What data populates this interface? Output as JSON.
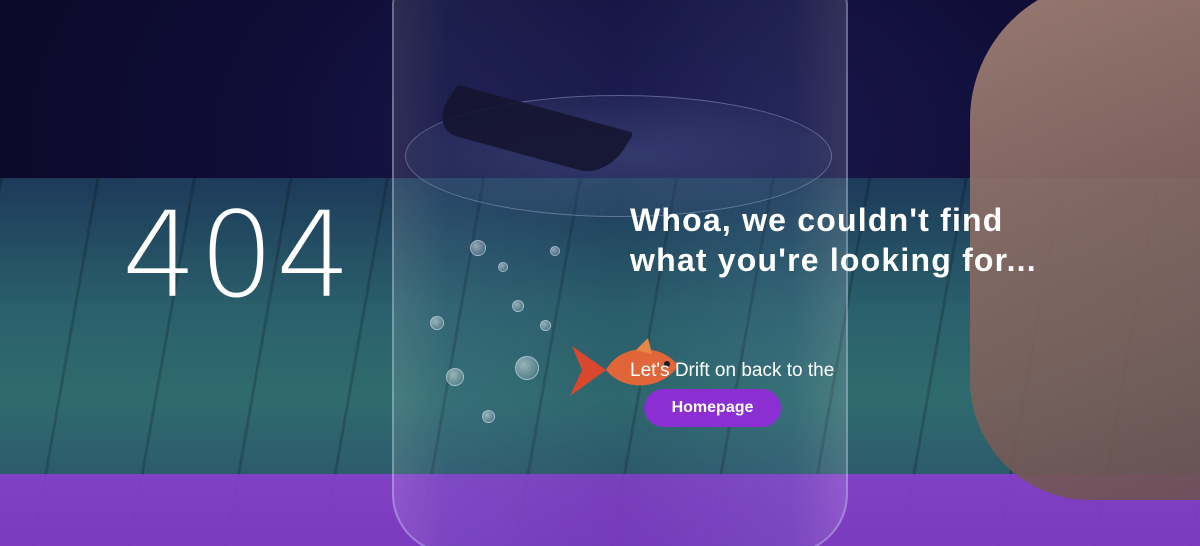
{
  "error": {
    "code": "404",
    "headline": "Whoa, we couldn't find what you're looking for...",
    "subtext": "Let's Drift on back to the",
    "button_label": "Homepage"
  },
  "colors": {
    "accent": "#8b2fd3",
    "overlay": "#0b0a2e",
    "band": "#8a3ece"
  }
}
